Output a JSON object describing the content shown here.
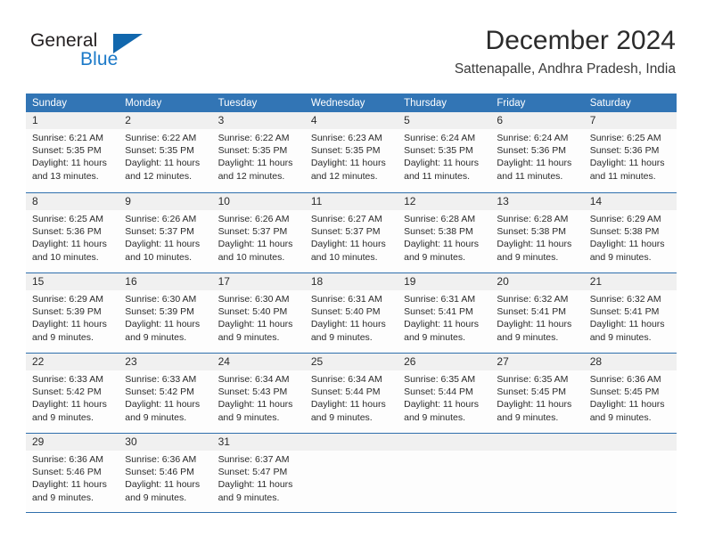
{
  "brand": {
    "name_top": "General",
    "name_bottom": "Blue",
    "triangle_color": "#1167ad",
    "blue_text_color": "#1b79c8"
  },
  "header": {
    "title": "December 2024",
    "subtitle": "Sattenapalle, Andhra Pradesh, India"
  },
  "colors": {
    "header_blue": "#3275b5",
    "row_divider_blue": "#2f6fad",
    "day_number_band": "#f0f0f0",
    "cell_background": "#fdfdfd"
  },
  "weekdays": [
    "Sunday",
    "Monday",
    "Tuesday",
    "Wednesday",
    "Thursday",
    "Friday",
    "Saturday"
  ],
  "weeks": [
    [
      {
        "day": "1",
        "sunrise": "Sunrise: 6:21 AM",
        "sunset": "Sunset: 5:35 PM",
        "daylight1": "Daylight: 11 hours",
        "daylight2": "and 13 minutes."
      },
      {
        "day": "2",
        "sunrise": "Sunrise: 6:22 AM",
        "sunset": "Sunset: 5:35 PM",
        "daylight1": "Daylight: 11 hours",
        "daylight2": "and 12 minutes."
      },
      {
        "day": "3",
        "sunrise": "Sunrise: 6:22 AM",
        "sunset": "Sunset: 5:35 PM",
        "daylight1": "Daylight: 11 hours",
        "daylight2": "and 12 minutes."
      },
      {
        "day": "4",
        "sunrise": "Sunrise: 6:23 AM",
        "sunset": "Sunset: 5:35 PM",
        "daylight1": "Daylight: 11 hours",
        "daylight2": "and 12 minutes."
      },
      {
        "day": "5",
        "sunrise": "Sunrise: 6:24 AM",
        "sunset": "Sunset: 5:35 PM",
        "daylight1": "Daylight: 11 hours",
        "daylight2": "and 11 minutes."
      },
      {
        "day": "6",
        "sunrise": "Sunrise: 6:24 AM",
        "sunset": "Sunset: 5:36 PM",
        "daylight1": "Daylight: 11 hours",
        "daylight2": "and 11 minutes."
      },
      {
        "day": "7",
        "sunrise": "Sunrise: 6:25 AM",
        "sunset": "Sunset: 5:36 PM",
        "daylight1": "Daylight: 11 hours",
        "daylight2": "and 11 minutes."
      }
    ],
    [
      {
        "day": "8",
        "sunrise": "Sunrise: 6:25 AM",
        "sunset": "Sunset: 5:36 PM",
        "daylight1": "Daylight: 11 hours",
        "daylight2": "and 10 minutes."
      },
      {
        "day": "9",
        "sunrise": "Sunrise: 6:26 AM",
        "sunset": "Sunset: 5:37 PM",
        "daylight1": "Daylight: 11 hours",
        "daylight2": "and 10 minutes."
      },
      {
        "day": "10",
        "sunrise": "Sunrise: 6:26 AM",
        "sunset": "Sunset: 5:37 PM",
        "daylight1": "Daylight: 11 hours",
        "daylight2": "and 10 minutes."
      },
      {
        "day": "11",
        "sunrise": "Sunrise: 6:27 AM",
        "sunset": "Sunset: 5:37 PM",
        "daylight1": "Daylight: 11 hours",
        "daylight2": "and 10 minutes."
      },
      {
        "day": "12",
        "sunrise": "Sunrise: 6:28 AM",
        "sunset": "Sunset: 5:38 PM",
        "daylight1": "Daylight: 11 hours",
        "daylight2": "and 9 minutes."
      },
      {
        "day": "13",
        "sunrise": "Sunrise: 6:28 AM",
        "sunset": "Sunset: 5:38 PM",
        "daylight1": "Daylight: 11 hours",
        "daylight2": "and 9 minutes."
      },
      {
        "day": "14",
        "sunrise": "Sunrise: 6:29 AM",
        "sunset": "Sunset: 5:38 PM",
        "daylight1": "Daylight: 11 hours",
        "daylight2": "and 9 minutes."
      }
    ],
    [
      {
        "day": "15",
        "sunrise": "Sunrise: 6:29 AM",
        "sunset": "Sunset: 5:39 PM",
        "daylight1": "Daylight: 11 hours",
        "daylight2": "and 9 minutes."
      },
      {
        "day": "16",
        "sunrise": "Sunrise: 6:30 AM",
        "sunset": "Sunset: 5:39 PM",
        "daylight1": "Daylight: 11 hours",
        "daylight2": "and 9 minutes."
      },
      {
        "day": "17",
        "sunrise": "Sunrise: 6:30 AM",
        "sunset": "Sunset: 5:40 PM",
        "daylight1": "Daylight: 11 hours",
        "daylight2": "and 9 minutes."
      },
      {
        "day": "18",
        "sunrise": "Sunrise: 6:31 AM",
        "sunset": "Sunset: 5:40 PM",
        "daylight1": "Daylight: 11 hours",
        "daylight2": "and 9 minutes."
      },
      {
        "day": "19",
        "sunrise": "Sunrise: 6:31 AM",
        "sunset": "Sunset: 5:41 PM",
        "daylight1": "Daylight: 11 hours",
        "daylight2": "and 9 minutes."
      },
      {
        "day": "20",
        "sunrise": "Sunrise: 6:32 AM",
        "sunset": "Sunset: 5:41 PM",
        "daylight1": "Daylight: 11 hours",
        "daylight2": "and 9 minutes."
      },
      {
        "day": "21",
        "sunrise": "Sunrise: 6:32 AM",
        "sunset": "Sunset: 5:41 PM",
        "daylight1": "Daylight: 11 hours",
        "daylight2": "and 9 minutes."
      }
    ],
    [
      {
        "day": "22",
        "sunrise": "Sunrise: 6:33 AM",
        "sunset": "Sunset: 5:42 PM",
        "daylight1": "Daylight: 11 hours",
        "daylight2": "and 9 minutes."
      },
      {
        "day": "23",
        "sunrise": "Sunrise: 6:33 AM",
        "sunset": "Sunset: 5:42 PM",
        "daylight1": "Daylight: 11 hours",
        "daylight2": "and 9 minutes."
      },
      {
        "day": "24",
        "sunrise": "Sunrise: 6:34 AM",
        "sunset": "Sunset: 5:43 PM",
        "daylight1": "Daylight: 11 hours",
        "daylight2": "and 9 minutes."
      },
      {
        "day": "25",
        "sunrise": "Sunrise: 6:34 AM",
        "sunset": "Sunset: 5:44 PM",
        "daylight1": "Daylight: 11 hours",
        "daylight2": "and 9 minutes."
      },
      {
        "day": "26",
        "sunrise": "Sunrise: 6:35 AM",
        "sunset": "Sunset: 5:44 PM",
        "daylight1": "Daylight: 11 hours",
        "daylight2": "and 9 minutes."
      },
      {
        "day": "27",
        "sunrise": "Sunrise: 6:35 AM",
        "sunset": "Sunset: 5:45 PM",
        "daylight1": "Daylight: 11 hours",
        "daylight2": "and 9 minutes."
      },
      {
        "day": "28",
        "sunrise": "Sunrise: 6:36 AM",
        "sunset": "Sunset: 5:45 PM",
        "daylight1": "Daylight: 11 hours",
        "daylight2": "and 9 minutes."
      }
    ],
    [
      {
        "day": "29",
        "sunrise": "Sunrise: 6:36 AM",
        "sunset": "Sunset: 5:46 PM",
        "daylight1": "Daylight: 11 hours",
        "daylight2": "and 9 minutes."
      },
      {
        "day": "30",
        "sunrise": "Sunrise: 6:36 AM",
        "sunset": "Sunset: 5:46 PM",
        "daylight1": "Daylight: 11 hours",
        "daylight2": "and 9 minutes."
      },
      {
        "day": "31",
        "sunrise": "Sunrise: 6:37 AM",
        "sunset": "Sunset: 5:47 PM",
        "daylight1": "Daylight: 11 hours",
        "daylight2": "and 9 minutes."
      },
      {
        "day": "",
        "sunrise": "",
        "sunset": "",
        "daylight1": "",
        "daylight2": ""
      },
      {
        "day": "",
        "sunrise": "",
        "sunset": "",
        "daylight1": "",
        "daylight2": ""
      },
      {
        "day": "",
        "sunrise": "",
        "sunset": "",
        "daylight1": "",
        "daylight2": ""
      },
      {
        "day": "",
        "sunrise": "",
        "sunset": "",
        "daylight1": "",
        "daylight2": ""
      }
    ]
  ]
}
